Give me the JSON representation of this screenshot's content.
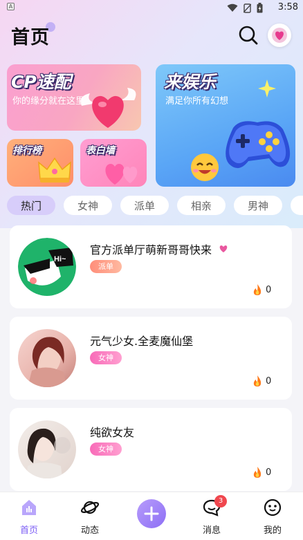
{
  "status_bar": {
    "time": "3:58",
    "app_icon_letter": "A"
  },
  "header": {
    "title": "首页"
  },
  "banners": {
    "cp": {
      "title": "CP速配",
      "subtitle": "你的缘分就在这里"
    },
    "fun": {
      "title": "来娱乐",
      "subtitle": "满足你所有幻想"
    },
    "rank": {
      "title": "排行榜"
    },
    "wall": {
      "title": "表白墙"
    }
  },
  "tabs": [
    {
      "label": "热门",
      "active": true
    },
    {
      "label": "女神",
      "active": false
    },
    {
      "label": "派单",
      "active": false
    },
    {
      "label": "相亲",
      "active": false
    },
    {
      "label": "男神",
      "active": false
    }
  ],
  "rooms": [
    {
      "name": "官方派单厅萌新哥哥快来",
      "tag": "派单",
      "heat": "0",
      "avatar_text": "Hi~"
    },
    {
      "name": "元气少女.全麦魔仙堡",
      "tag": "女神",
      "heat": "0"
    },
    {
      "name": "纯欲女友",
      "tag": "女神",
      "heat": "0"
    }
  ],
  "bottom_nav": [
    {
      "label": "首页",
      "icon": "home-icon",
      "active": true
    },
    {
      "label": "动态",
      "icon": "planet-icon",
      "active": false
    },
    {
      "label": "消息",
      "icon": "message-icon",
      "active": false,
      "badge": "3"
    },
    {
      "label": "我的",
      "icon": "profile-icon",
      "active": false
    }
  ],
  "colors": {
    "accent": "#7b5cf5",
    "badge": "#f0474e",
    "tag_orange": "#ff8e7a",
    "tag_pink": "#f86bb8"
  }
}
